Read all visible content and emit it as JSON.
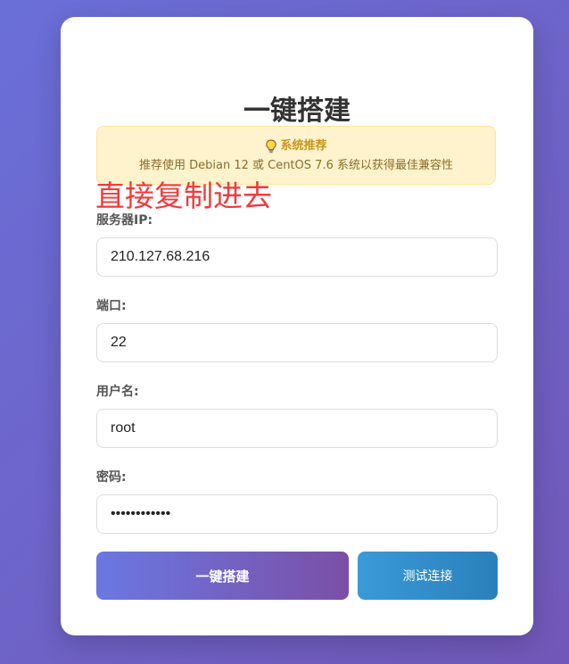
{
  "page": {
    "title": "一键搭建"
  },
  "notice": {
    "icon": "lightbulb-icon",
    "heading": "系统推荐",
    "body": "推荐使用 Debian 12 或 CentOS 7.6 系统以获得最佳兼容性"
  },
  "annotation": {
    "text": "直接复制进去",
    "color": "#ef3b3b"
  },
  "form": {
    "server_ip": {
      "label": "服务器IP:",
      "value": "210.127.68.216"
    },
    "port": {
      "label": "端口:",
      "value": "22"
    },
    "username": {
      "label": "用户名:",
      "value": "root"
    },
    "password": {
      "label": "密码:",
      "value": "••••••••••••"
    }
  },
  "actions": {
    "build_label": "一键搭建",
    "test_label": "测试连接"
  },
  "colors": {
    "background_start": "#6a6fd8",
    "background_end": "#7158b8",
    "notice_bg": "#fff3cd",
    "notice_heading": "#c8961a",
    "primary_start": "#6b78e2",
    "primary_end": "#7a4fa6",
    "secondary_start": "#3a9ad8",
    "secondary_end": "#2a80bb"
  }
}
